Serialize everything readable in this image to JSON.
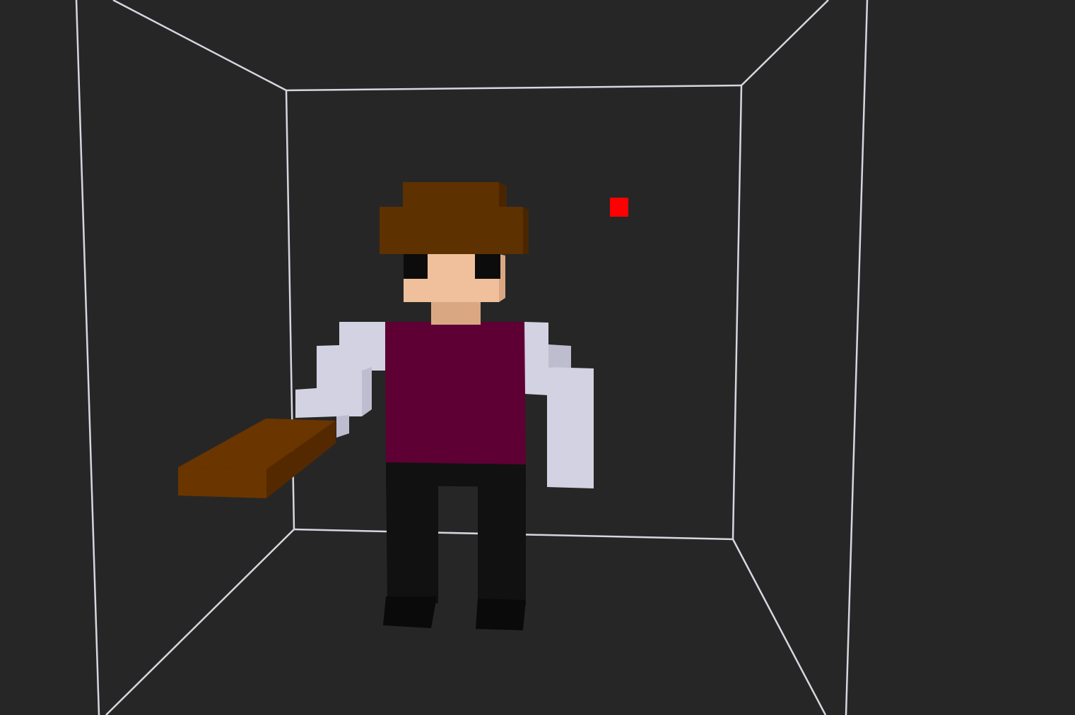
{
  "scene": {
    "background": "#262626",
    "wireframe_color": "#d6d6e0",
    "marker_color": "#ff0000"
  },
  "character": {
    "hair_color": "#5e3100",
    "hair_shade": "#4a2600",
    "skin_color": "#f0c09c",
    "skin_shade": "#d9a882",
    "eye_color": "#0c0c0c",
    "shirt_color": "#5e0033",
    "sleeve_color": "#d3d2e2",
    "sleeve_shade": "#bebdd0",
    "pants_color": "#111111",
    "shoe_color": "#0a0a0a"
  },
  "held_item": {
    "name": "wooden-plank",
    "color": "#6b3500",
    "shade": "#552900"
  }
}
